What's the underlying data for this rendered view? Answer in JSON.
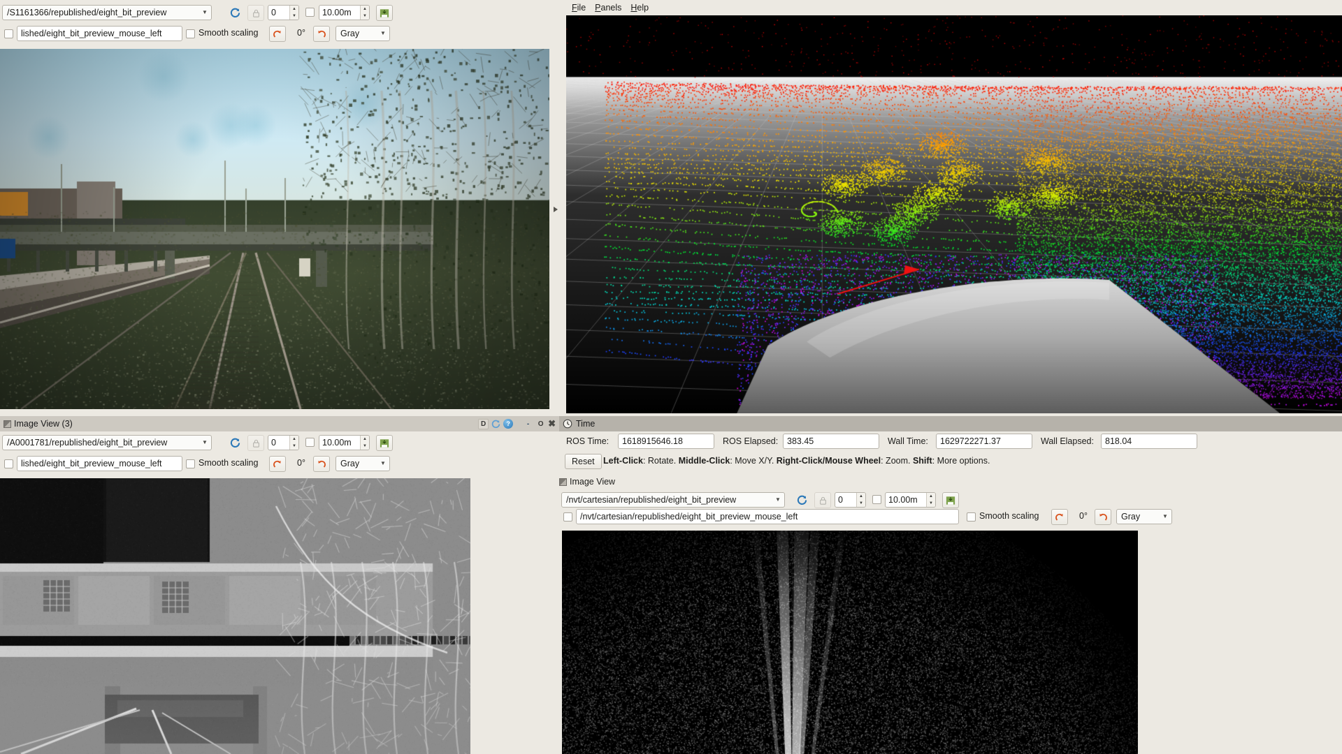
{
  "app": {
    "menu": [
      {
        "label": "File",
        "mnemonic": "F"
      },
      {
        "label": "Panels",
        "mnemonic": "P"
      },
      {
        "label": "Help",
        "mnemonic": "H"
      }
    ]
  },
  "image_view_1": {
    "topic": "/S1161366/republished/eight_bit_preview",
    "queue_value": "0",
    "range_value": "10.00m",
    "mouse_topic": "lished/eight_bit_preview_mouse_left",
    "smooth_scaling_label": "Smooth scaling",
    "rotation_label": "0°",
    "colormap": "Gray",
    "icons": {
      "refresh": "refresh-icon",
      "lock": "lock-icon",
      "save": "save-icon",
      "rotate_cw": "rotate-cw-icon",
      "rotate_ccw": "rotate-ccw-icon"
    }
  },
  "image_view_3": {
    "panel_title": "Image View (3)",
    "topic": "/A0001781/republished/eight_bit_preview",
    "queue_value": "0",
    "range_value": "10.00m",
    "mouse_topic": "lished/eight_bit_preview_mouse_left",
    "smooth_scaling_label": "Smooth scaling",
    "rotation_label": "0°",
    "colormap": "Gray",
    "window_buttons": {
      "dock": "D",
      "float": "C",
      "help": "?",
      "minimize": "-",
      "maximize": "O",
      "close": "✖"
    }
  },
  "time_panel": {
    "panel_title": "Time",
    "fields": [
      {
        "label": "ROS Time:",
        "value": "1618915646.18"
      },
      {
        "label": "ROS Elapsed:",
        "value": "383.45"
      },
      {
        "label": "Wall Time:",
        "value": "1629722271.37"
      },
      {
        "label": "Wall Elapsed:",
        "value": "818.04"
      }
    ],
    "reset_label": "Reset",
    "hint_segments": [
      {
        "text": "Left-Click",
        "bold": true
      },
      {
        "text": ": Rotate. ",
        "bold": false
      },
      {
        "text": "Middle-Click",
        "bold": true
      },
      {
        "text": ": Move X/Y. ",
        "bold": false
      },
      {
        "text": "Right-Click/Mouse Wheel",
        "bold": true
      },
      {
        "text": ": Zoom. ",
        "bold": false
      },
      {
        "text": "Shift",
        "bold": true
      },
      {
        "text": ": More options.",
        "bold": false
      }
    ],
    "hint_plain": "Left-Click: Rotate. Middle-Click: Move X/Y. Right-Click/Mouse Wheel: Zoom. Shift: More options."
  },
  "image_view_4": {
    "panel_title": "Image View",
    "topic": "/nvt/cartesian/republished/eight_bit_preview",
    "queue_value": "0",
    "range_value": "10.00m",
    "mouse_topic": "/nvt/cartesian/republished/eight_bit_preview_mouse_left",
    "smooth_scaling_label": "Smooth scaling",
    "rotation_label": "0°",
    "colormap": "Gray"
  },
  "colors": {
    "background": "#ece9e2",
    "panel_title_bar": "#b6b2aa",
    "field_border": "#b6b2a9",
    "accent_orange": "#d9541f",
    "accent_blue": "#2b78b8",
    "canvas_black": "#000000"
  },
  "views": {
    "rgb_camera": "front-facing railway RGB camera image",
    "pointcloud_3d": "RViz 3D LiDAR point cloud, rainbow height coloring",
    "thermal_camera": "grayscale thermal / IR camera image of railway bridge",
    "radar_polar": "polar navigation radar intensity image"
  }
}
